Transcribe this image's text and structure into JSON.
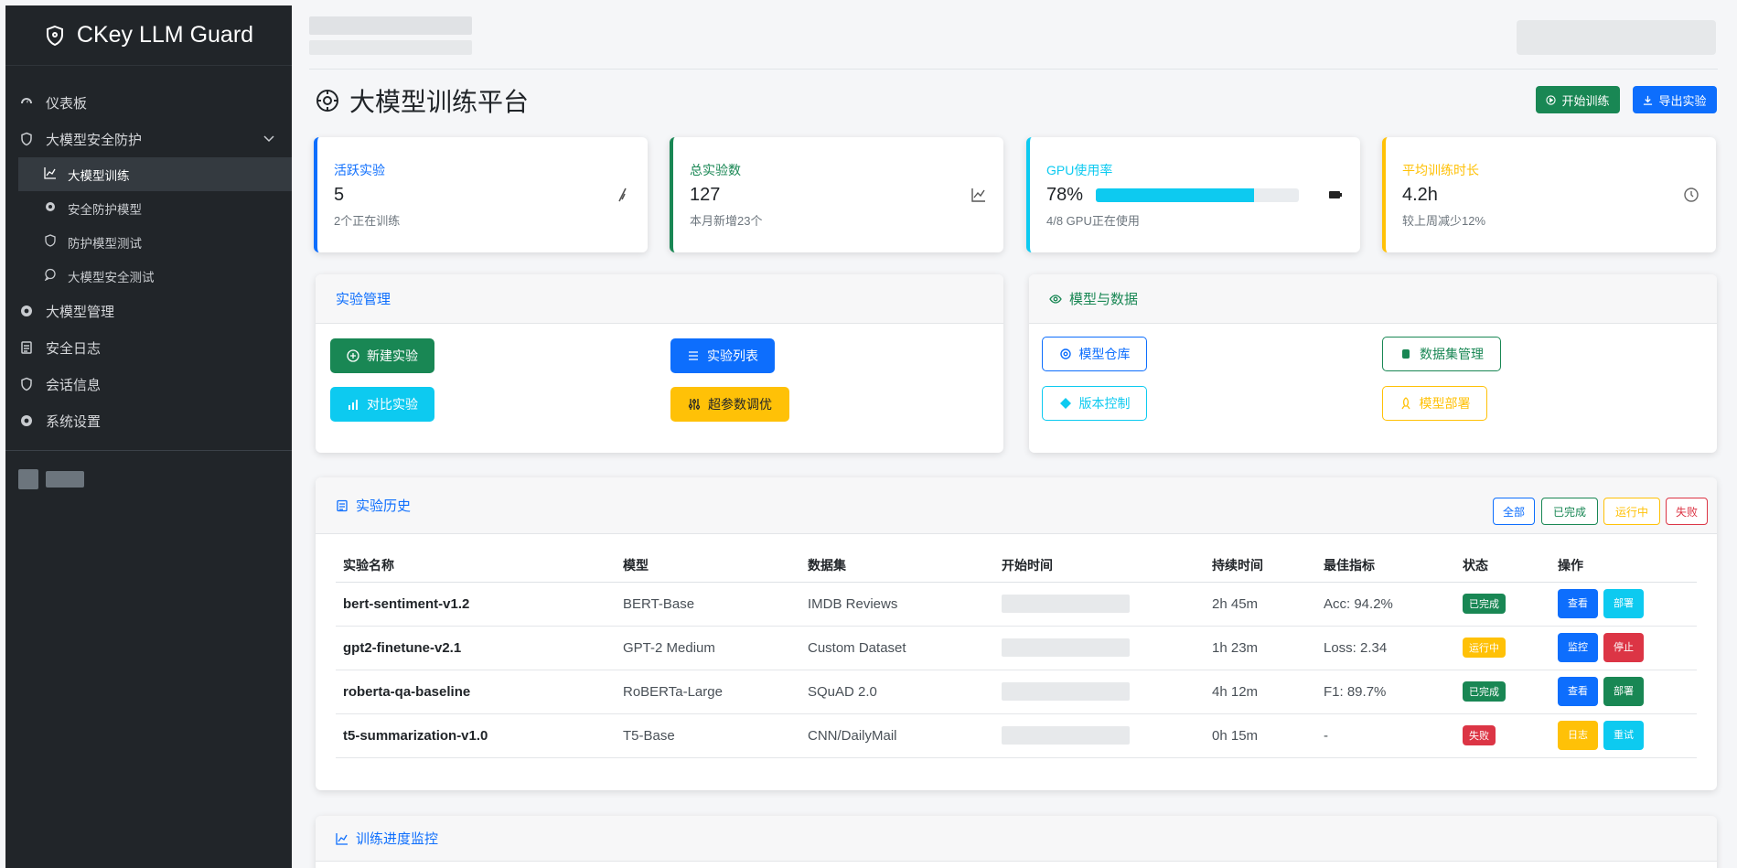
{
  "brand": {
    "name": "CKey LLM Guard",
    "icon": "shield-icon"
  },
  "sidebar": {
    "items": [
      {
        "label": "仪表板",
        "icon": "gauge-icon"
      },
      {
        "label": "大模型安全防护",
        "icon": "shield-icon",
        "expanded": true,
        "children": [
          {
            "label": "大模型训练",
            "icon": "chart-line-icon",
            "active": true
          },
          {
            "label": "安全防护模型",
            "icon": "gear-icon"
          },
          {
            "label": "防护模型测试",
            "icon": "shield-icon"
          },
          {
            "label": "大模型安全测试",
            "icon": "chat-icon"
          }
        ]
      },
      {
        "label": "大模型管理",
        "icon": "gear-icon"
      },
      {
        "label": "安全日志",
        "icon": "log-icon"
      },
      {
        "label": "会话信息",
        "icon": "shield-icon"
      },
      {
        "label": "系统设置",
        "icon": "gear-icon"
      }
    ]
  },
  "page": {
    "title": "大模型训练平台",
    "title_icon": "gear-icon",
    "start_btn": "开始训练",
    "export_btn": "导出实验"
  },
  "stats": [
    {
      "label": "活跃实验",
      "value": "5",
      "sub": "2个正在训练",
      "icon": "wave-icon",
      "color": "#0d6efd"
    },
    {
      "label": "总实验数",
      "value": "127",
      "sub": "本月新增23个",
      "icon": "chart-line-icon",
      "color": "#198754"
    },
    {
      "label": "GPU使用率",
      "value": "78%",
      "sub": "4/8 GPU正在使用",
      "icon": "gpu-icon",
      "color": "#0dcaf0",
      "progress": 0.78
    },
    {
      "label": "平均训练时长",
      "value": "4.2h",
      "sub": "较上周减少12%",
      "icon": "clock-icon",
      "color": "#ffc107"
    }
  ],
  "experiment_mgmt": {
    "title": "实验管理",
    "buttons": [
      {
        "label": "新建实验",
        "color": "#198754",
        "icon": "plus-circle-icon"
      },
      {
        "label": "实验列表",
        "color": "#0d6efd",
        "icon": "list-icon"
      },
      {
        "label": "对比实验",
        "color": "#0dcaf0",
        "icon": "bar-chart-icon"
      },
      {
        "label": "超参数调优",
        "color": "#ffc107",
        "icon": "sliders-icon"
      }
    ]
  },
  "model_data": {
    "title": "模型与数据",
    "buttons": [
      {
        "label": "模型仓库",
        "color": "#0d6efd",
        "icon": "gear-icon"
      },
      {
        "label": "数据集管理",
        "color": "#198754",
        "icon": "database-icon"
      },
      {
        "label": "版本控制",
        "color": "#0dcaf0",
        "icon": "branch-icon"
      },
      {
        "label": "模型部署",
        "color": "#ffc107",
        "icon": "rocket-icon"
      }
    ]
  },
  "history": {
    "title": "实验历史",
    "filters": [
      {
        "label": "全部",
        "color": "#0d6efd"
      },
      {
        "label": "已完成",
        "color": "#198754"
      },
      {
        "label": "运行中",
        "color": "#ffc107"
      },
      {
        "label": "失败",
        "color": "#dc3545"
      }
    ],
    "columns": [
      "实验名称",
      "模型",
      "数据集",
      "开始时间",
      "持续时间",
      "最佳指标",
      "状态",
      "操作"
    ],
    "rows": [
      {
        "name": "bert-sentiment-v1.2",
        "model": "BERT-Base",
        "dataset": "IMDB Reviews",
        "duration": "2h 45m",
        "metric": "Acc: 94.2%",
        "status": "已完成",
        "status_color": "#198754",
        "ops": [
          {
            "label": "查看",
            "color": "#0d6efd"
          },
          {
            "label": "部署",
            "color": "#0dcaf0"
          }
        ]
      },
      {
        "name": "gpt2-finetune-v2.1",
        "model": "GPT-2 Medium",
        "dataset": "Custom Dataset",
        "duration": "1h 23m",
        "metric": "Loss: 2.34",
        "status": "运行中",
        "status_color": "#ffc107",
        "ops": [
          {
            "label": "监控",
            "color": "#0d6efd"
          },
          {
            "label": "停止",
            "color": "#dc3545"
          }
        ]
      },
      {
        "name": "roberta-qa-baseline",
        "model": "RoBERTa-Large",
        "dataset": "SQuAD 2.0",
        "duration": "4h 12m",
        "metric": "F1: 89.7%",
        "status": "已完成",
        "status_color": "#198754",
        "ops": [
          {
            "label": "查看",
            "color": "#0d6efd"
          },
          {
            "label": "部署",
            "color": "#198754"
          }
        ]
      },
      {
        "name": "t5-summarization-v1.0",
        "model": "T5-Base",
        "dataset": "CNN/DailyMail",
        "duration": "0h 15m",
        "metric": "-",
        "status": "失败",
        "status_color": "#dc3545",
        "ops": [
          {
            "label": "日志",
            "color": "#ffc107"
          },
          {
            "label": "重试",
            "color": "#0dcaf0"
          }
        ]
      }
    ]
  },
  "monitor": {
    "title": "训练进度监控"
  }
}
